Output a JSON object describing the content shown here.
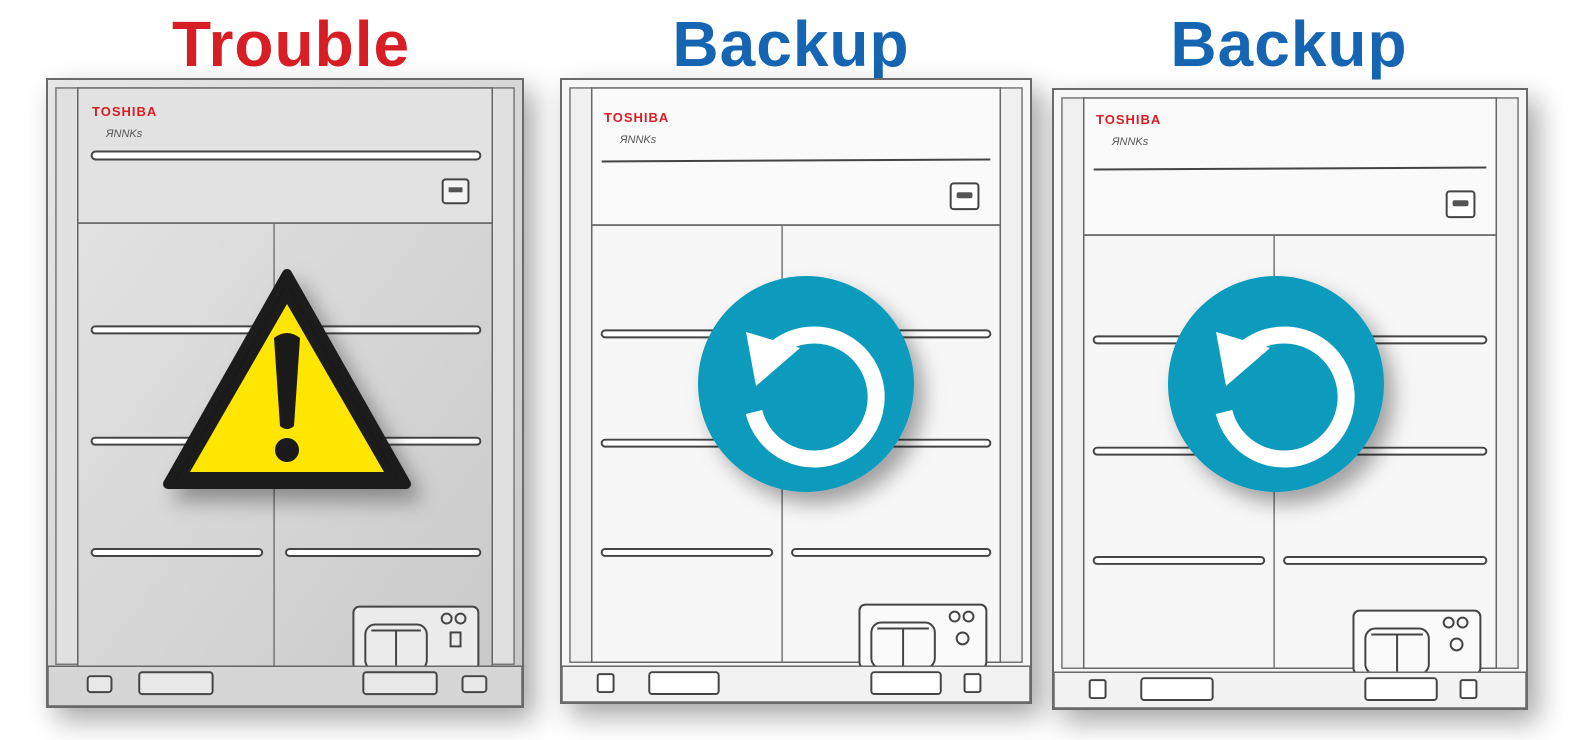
{
  "units": [
    {
      "label": "Trouble",
      "label_color": "#d81e25",
      "brand": "TOSHIBA",
      "model": "ЯNNKs",
      "status": "trouble",
      "icon": "warning-triangle-icon",
      "body_color": "#d6d6d6"
    },
    {
      "label": "Backup",
      "label_color": "#1565b3",
      "brand": "TOSHIBA",
      "model": "ЯNNKs",
      "status": "backup",
      "icon": "backup-rotate-icon",
      "body_color": "#f7f7f7"
    },
    {
      "label": "Backup",
      "label_color": "#1565b3",
      "brand": "TOSHIBA",
      "model": "ЯNNKs",
      "status": "backup",
      "icon": "backup-rotate-icon",
      "body_color": "#f7f7f7"
    }
  ],
  "colors": {
    "brand": "#d81e25",
    "warning_yellow": "#ffe600",
    "backup_teal": "#0e9bbd"
  }
}
